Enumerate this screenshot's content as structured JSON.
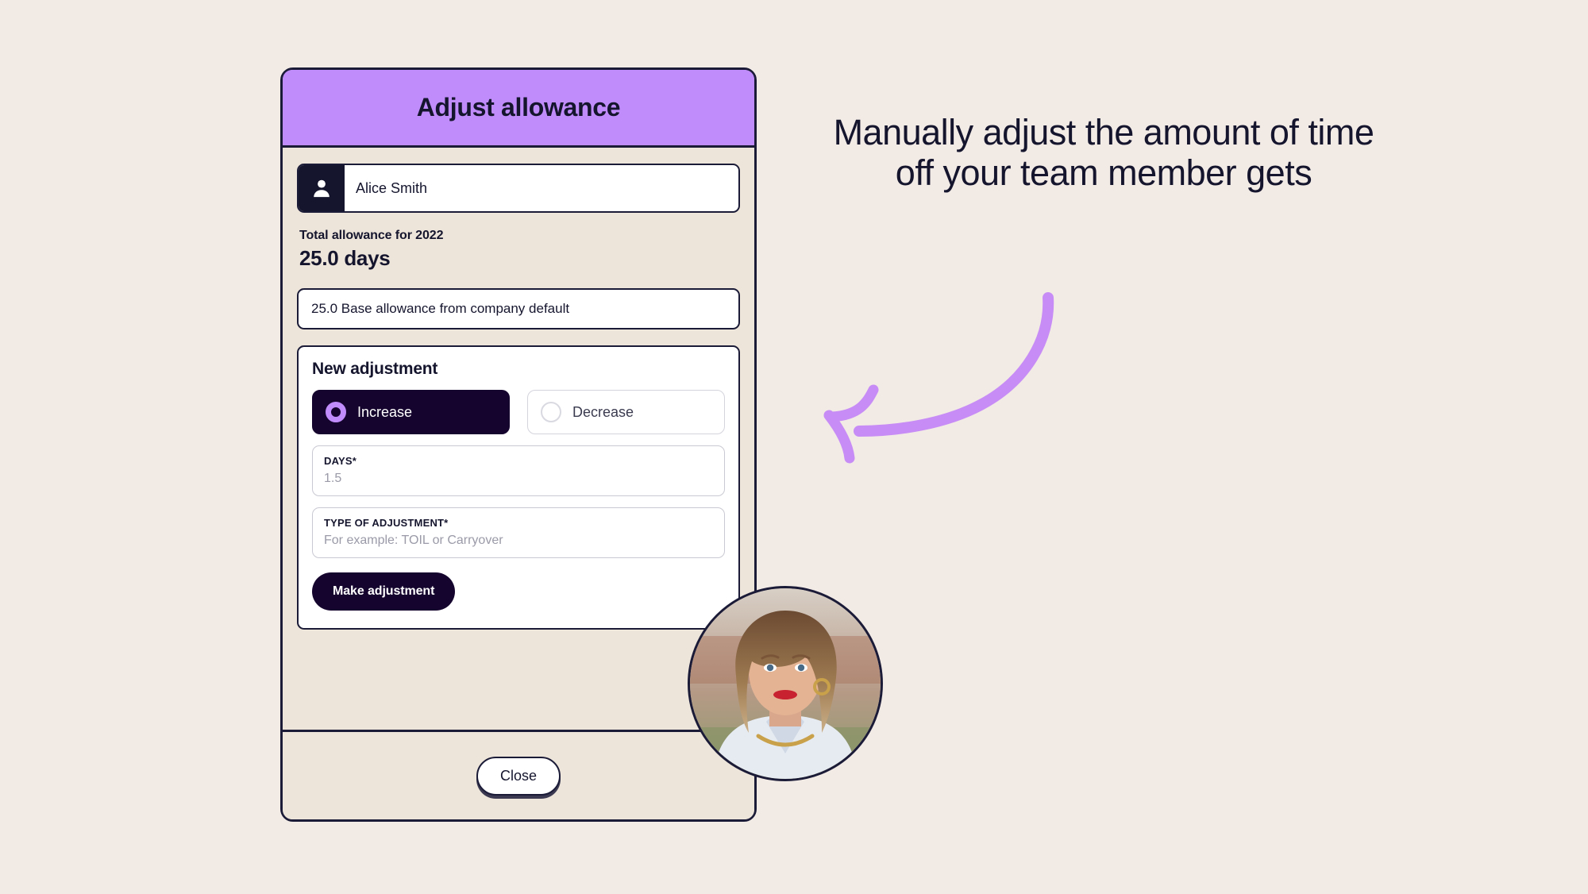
{
  "page": {
    "background_color": "#f2eae5"
  },
  "modal": {
    "header": {
      "title": "Adjust allowance",
      "background_color": "#c08cfb"
    },
    "member": {
      "avatar_icon": "person-icon",
      "name": "Alice Smith"
    },
    "total_allowance": {
      "label": "Total allowance for 2022",
      "value": "25.0 days"
    },
    "base_allowance": {
      "text": "25.0 Base allowance from company default"
    },
    "new_adjustment": {
      "title": "New adjustment",
      "options": [
        {
          "label": "Increase",
          "selected": true
        },
        {
          "label": "Decrease",
          "selected": false
        }
      ],
      "fields": [
        {
          "label": "DAYS*",
          "value": "",
          "placeholder": "1.5"
        },
        {
          "label": "TYPE OF ADJUSTMENT*",
          "value": "",
          "placeholder": "For example: TOIL or Carryover"
        }
      ],
      "submit_label": "Make adjustment"
    },
    "footer": {
      "close_label": "Close"
    }
  },
  "annotation": {
    "text": "Manually adjust the amount of time off your team member gets",
    "arrow_color": "#c78cf5",
    "arrow_icon": "curved-arrow-left-icon"
  },
  "avatar_photo": {
    "alt": "presenter-headshot"
  }
}
